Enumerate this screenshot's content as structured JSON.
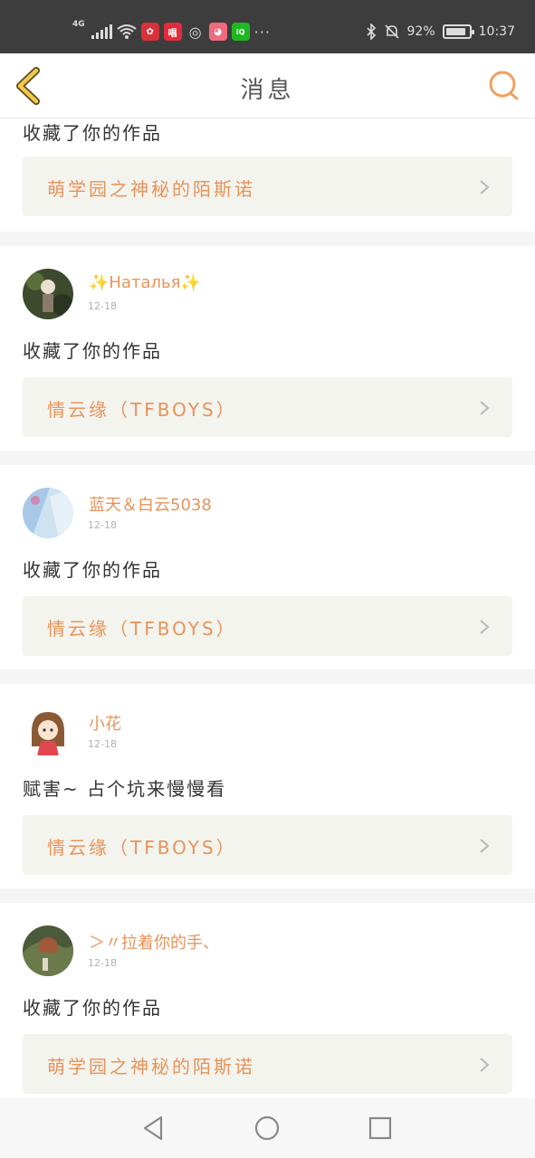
{
  "status_bar": {
    "network": "4G",
    "app_icons": [
      "huawei-icon",
      "changba-icon",
      "wechat-icon",
      "pig-app-icon",
      "iqiyi-icon"
    ],
    "battery": "92%",
    "battery_level": 0.92,
    "time": "10:37"
  },
  "header": {
    "title": "消息"
  },
  "colors": {
    "accent": "#e8935a",
    "back_icon": "#f2c94c",
    "search_icon": "#f0a060"
  },
  "feed": {
    "partial_item": {
      "action": "收藏了你的作品",
      "work_title": "萌学园之神秘的陌斯诺"
    },
    "items": [
      {
        "name": "✨Наталья✨",
        "date": "12-18",
        "action": "收藏了你的作品",
        "work_title": "情云缘（TFBOYS）"
      },
      {
        "name": "蓝天＆白云5038",
        "date": "12-18",
        "action": "收藏了你的作品",
        "work_title": "情云缘（TFBOYS）"
      },
      {
        "name": "小花",
        "date": "12-18",
        "action": "赋害~ 占个坑来慢慢看",
        "work_title": "情云缘（TFBOYS）"
      },
      {
        "name": "＞〃拉着你的手、",
        "date": "12-18",
        "action": "收藏了你的作品",
        "work_title": "萌学园之神秘的陌斯诺"
      }
    ]
  }
}
